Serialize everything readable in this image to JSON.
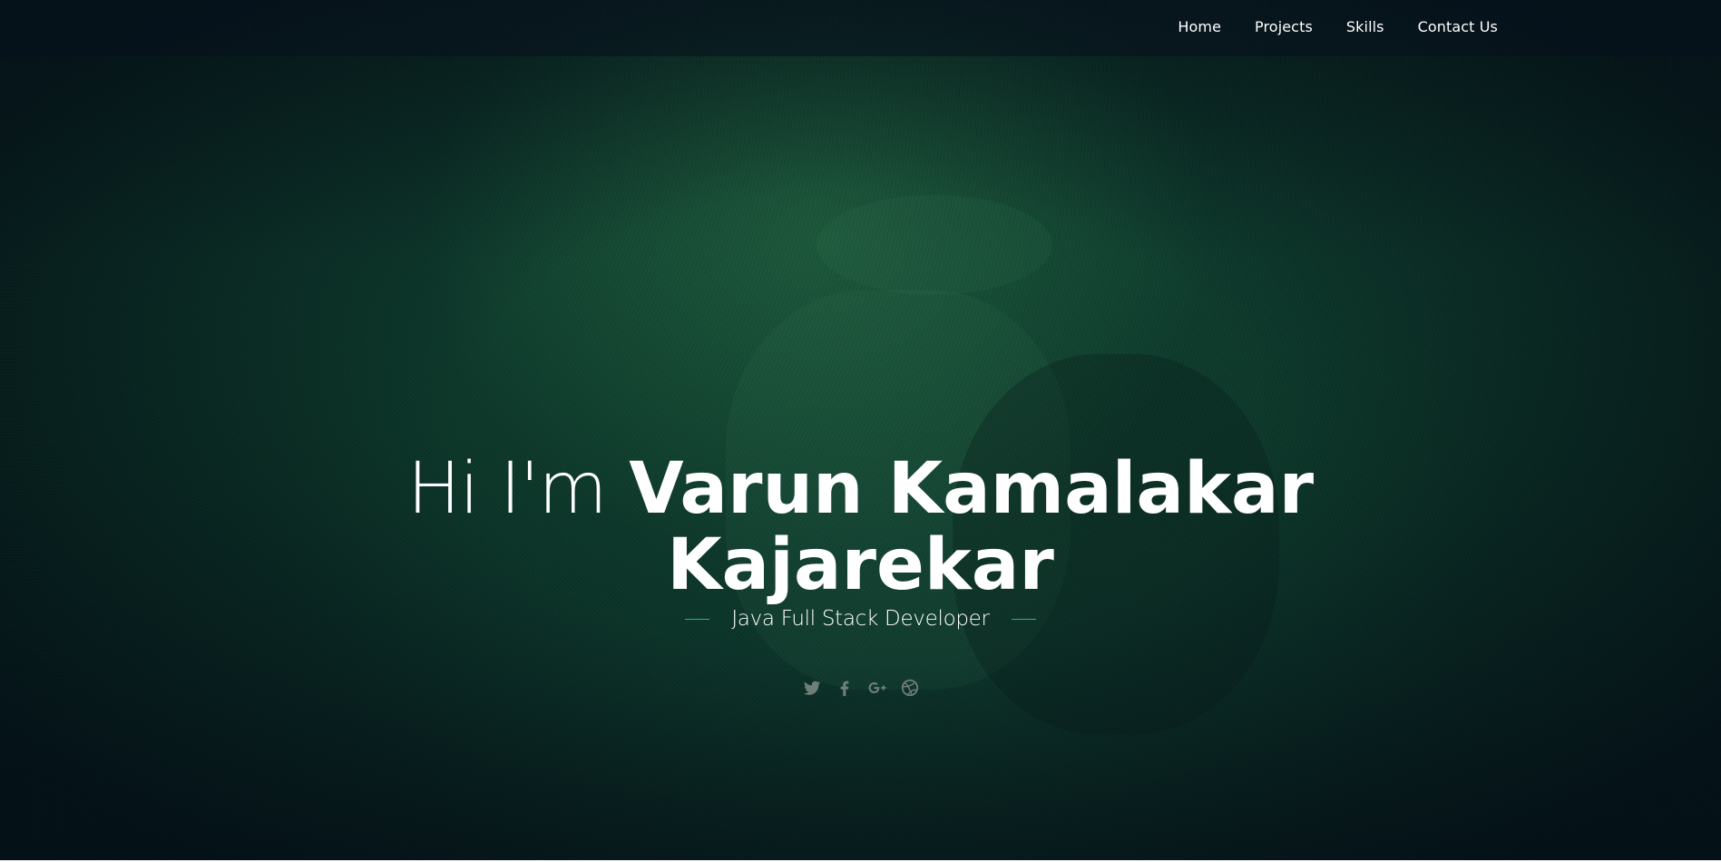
{
  "nav": {
    "items": [
      {
        "label": "Home"
      },
      {
        "label": "Projects"
      },
      {
        "label": "Skills"
      },
      {
        "label": "Contact Us"
      }
    ]
  },
  "hero": {
    "greeting": "Hi I'm",
    "name_line1": "Varun Kamalakar",
    "name_line2": "Kajarekar",
    "subtitle": "Java Full Stack Developer",
    "social_icons": [
      "twitter-icon",
      "facebook-icon",
      "google-plus-icon",
      "dribbble-icon"
    ],
    "accent_color": "#2bb38a",
    "icon_color": "#6f7f78"
  }
}
